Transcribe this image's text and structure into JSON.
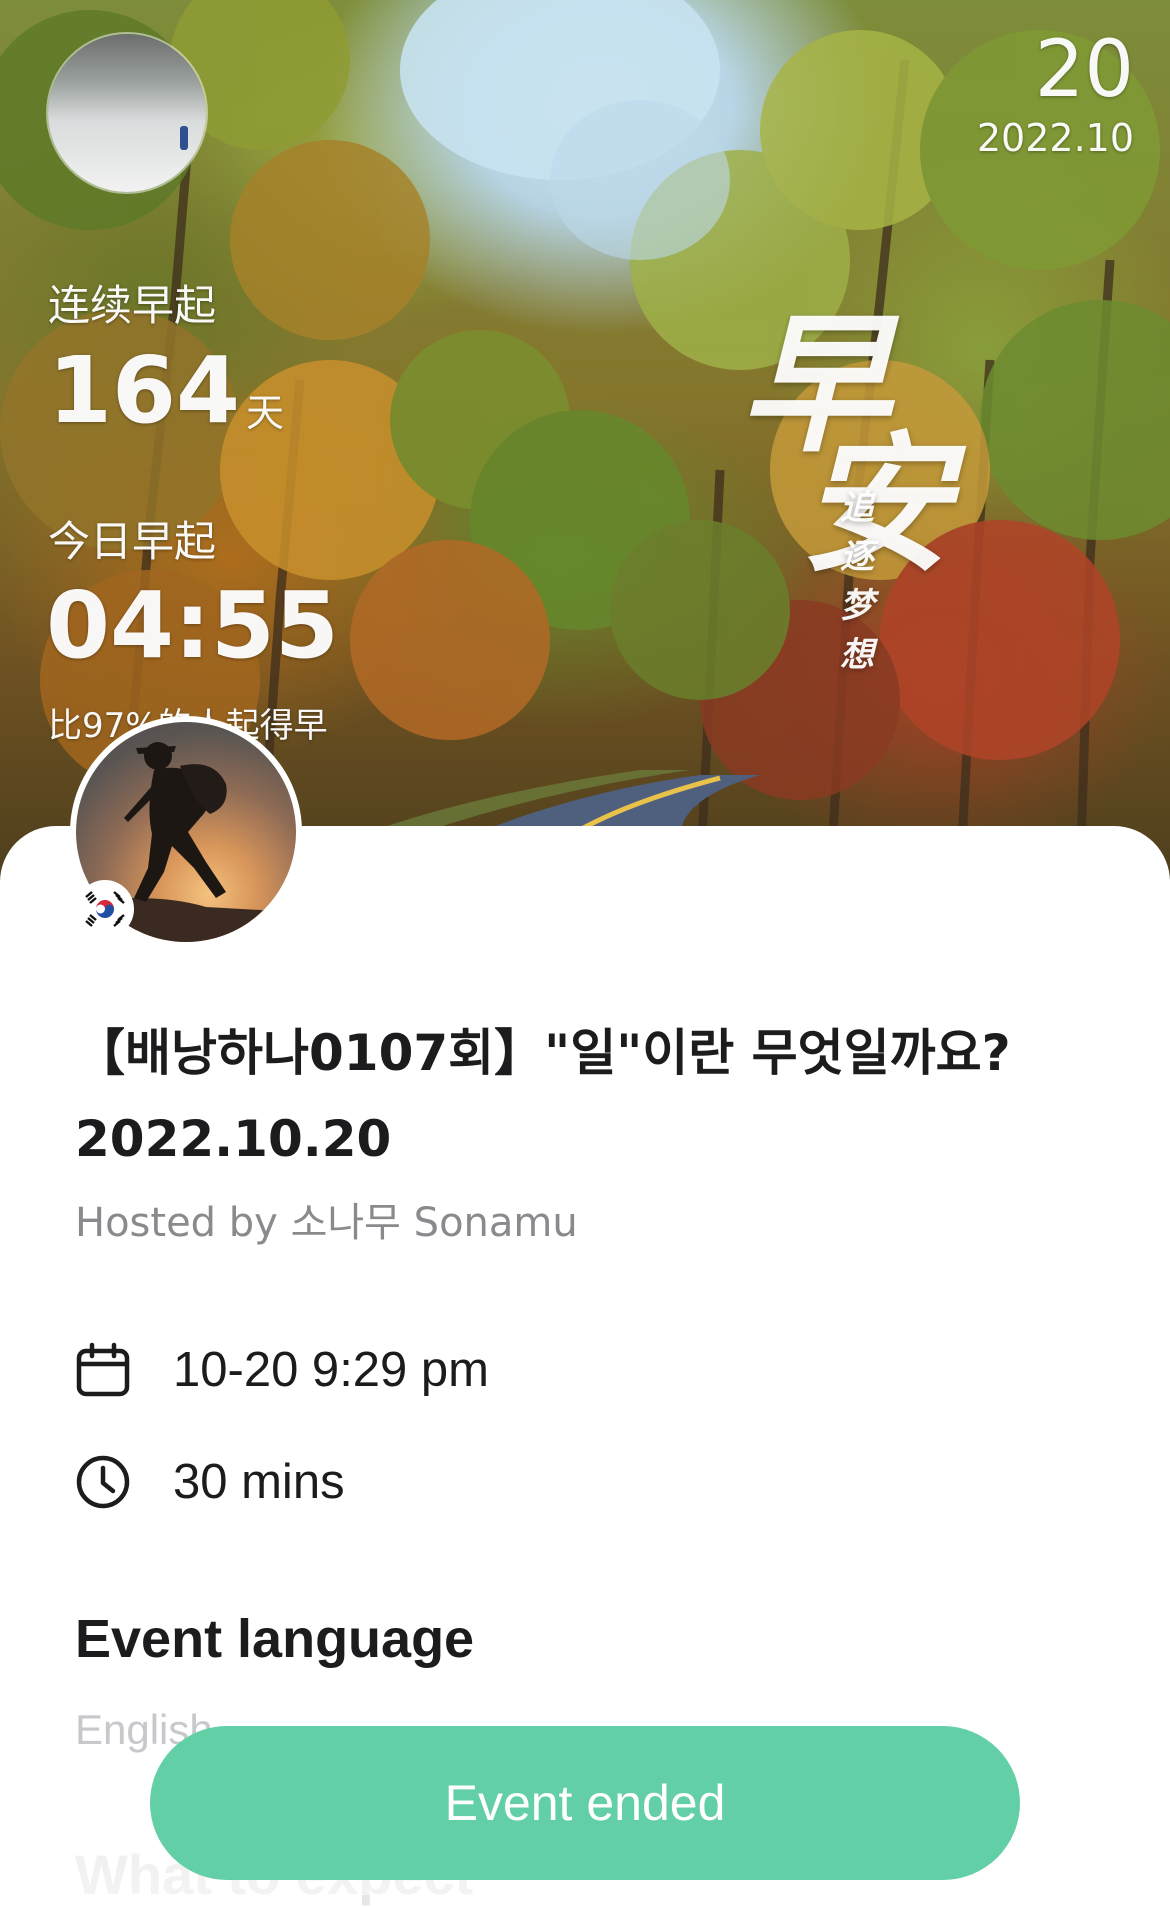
{
  "hero": {
    "streak_label": "连续早起",
    "streak_value": "164",
    "streak_unit": "天",
    "today_label": "今日早起",
    "today_time": "04:55",
    "compare_text": "比97%的人起得早",
    "date_day": "20",
    "date_month": "2022.10",
    "calligraphy_char1": "早",
    "calligraphy_char2": "安",
    "calligraphy_slogan": "追逐梦想"
  },
  "host": {
    "flag": "south-korea-flag-icon"
  },
  "event": {
    "title": "【배낭하나0107회】\"일\"이란 무엇일까요? 2022.10.20",
    "hosted_by": "Hosted by 소나무 Sonamu",
    "date_time": "10-20 9:29 pm",
    "duration": "30 mins",
    "language_heading": "Event language",
    "language_value": "English",
    "next_heading": "What to expect"
  },
  "actions": {
    "status_button": "Event ended"
  },
  "colors": {
    "accent": "#63cfa6",
    "title_text": "#1c1c1e",
    "secondary_text": "#8a8a8e",
    "muted_text": "#c7c7cc"
  }
}
